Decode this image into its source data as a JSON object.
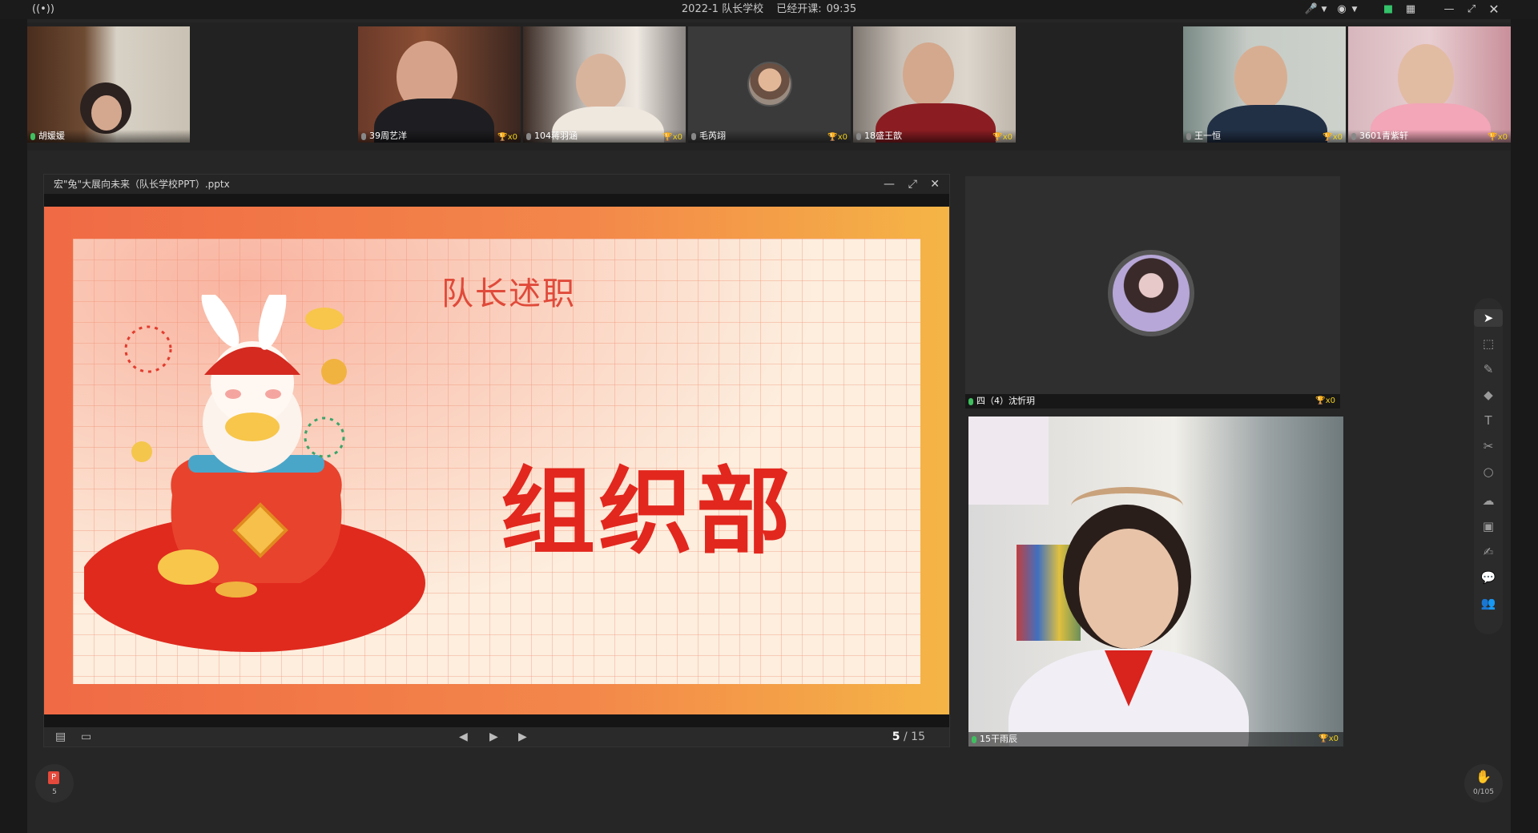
{
  "titlebar": {
    "class_name": "2022-1 队长学校",
    "status_label": "已经开课:",
    "time": "09:35"
  },
  "participants": [
    {
      "name": "胡媛媛",
      "mic": "on"
    },
    {
      "name": "39周艺洋",
      "trophy": "x0"
    },
    {
      "name": "104蒋羽涵",
      "trophy": "x0"
    },
    {
      "name": "毛芮翊",
      "trophy": "x0"
    },
    {
      "name": "18盛王歆",
      "trophy": "x0"
    },
    {
      "name": "王一恒",
      "trophy": "x0"
    },
    {
      "name": "3601青紫轩",
      "trophy": "x0"
    }
  ],
  "ppt": {
    "filename": "宏\"兔\"大展向未来（队长学校PPT）.pptx",
    "slide_subtitle": "队长述职",
    "slide_title": "组织部",
    "page_current": "5",
    "page_sep": "/",
    "page_total": "15"
  },
  "cameras": {
    "avatar_name": "四（4）沈忻玥",
    "avatar_trophy": "x0",
    "video_name": "15干雨辰",
    "video_trophy": "x0"
  },
  "bottom": {
    "ppt_count": "5",
    "hand_count": "0/105"
  },
  "colors": {
    "slide_red": "#e2271e",
    "mic_on": "#3fbf5f",
    "trophy": "#f2d21b"
  }
}
